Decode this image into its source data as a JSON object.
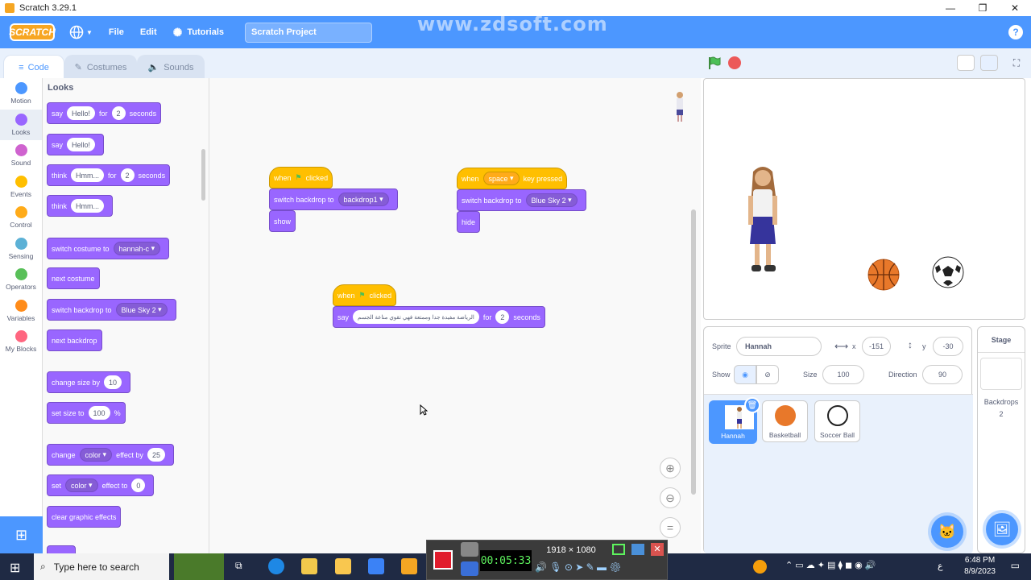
{
  "window": {
    "title": "Scratch 3.29.1",
    "min": "—",
    "max": "❐",
    "close": "✕"
  },
  "menu": {
    "logo": "SCRATCH",
    "file": "File",
    "edit": "Edit",
    "tutorials": "Tutorials",
    "project_title": "Scratch Project",
    "watermark": "www.zdsoft.com",
    "help": "?"
  },
  "tabs": {
    "code": "Code",
    "costumes": "Costumes",
    "sounds": "Sounds"
  },
  "categories": [
    {
      "label": "Motion",
      "color": "#4c97ff"
    },
    {
      "label": "Looks",
      "color": "#9966ff"
    },
    {
      "label": "Sound",
      "color": "#cf63cf"
    },
    {
      "label": "Events",
      "color": "#ffbf00"
    },
    {
      "label": "Control",
      "color": "#ffab19"
    },
    {
      "label": "Sensing",
      "color": "#5cb1d6"
    },
    {
      "label": "Operators",
      "color": "#59c059"
    },
    {
      "label": "Variables",
      "color": "#ff8c1a"
    },
    {
      "label": "My Blocks",
      "color": "#ff6680"
    }
  ],
  "palette": {
    "heading": "Looks",
    "say_for": {
      "a": "say",
      "b": "Hello!",
      "c": "for",
      "d": "2",
      "e": "seconds"
    },
    "say": {
      "a": "say",
      "b": "Hello!"
    },
    "think_for": {
      "a": "think",
      "b": "Hmm...",
      "c": "for",
      "d": "2",
      "e": "seconds"
    },
    "think": {
      "a": "think",
      "b": "Hmm..."
    },
    "switch_costume": {
      "a": "switch costume to",
      "b": "hannah-c"
    },
    "next_costume": "next costume",
    "switch_backdrop": {
      "a": "switch backdrop to",
      "b": "Blue Sky 2"
    },
    "next_backdrop": "next backdrop",
    "change_size": {
      "a": "change size by",
      "b": "10"
    },
    "set_size": {
      "a": "set size to",
      "b": "100",
      "c": "%"
    },
    "change_effect": {
      "a": "change",
      "b": "color",
      "c": "effect by",
      "d": "25"
    },
    "set_effect": {
      "a": "set",
      "b": "color",
      "c": "effect to",
      "d": "0"
    },
    "clear_effects": "clear graphic effects"
  },
  "scripts": {
    "s1": {
      "when": "when",
      "clicked": "clicked",
      "switch": "switch backdrop to",
      "backdrop": "backdrop1",
      "show": "show"
    },
    "s2": {
      "when": "when",
      "key": "space",
      "pressed": "key pressed",
      "switch": "switch backdrop to",
      "backdrop": "Blue Sky 2",
      "hide": "hide"
    },
    "s3": {
      "when": "when",
      "clicked": "clicked",
      "say": "say",
      "text": "الرياضة مفيدة جدا وممتعة فهي تقوي مناعة الجسم",
      "for": "for",
      "secs": "2",
      "seconds": "seconds"
    }
  },
  "sprite_info": {
    "sprite_label": "Sprite",
    "sprite_name": "Hannah",
    "x_label": "x",
    "x": "-151",
    "y_label": "y",
    "y": "-30",
    "show_label": "Show",
    "size_label": "Size",
    "size": "100",
    "direction_label": "Direction",
    "direction": "90"
  },
  "sprites": [
    "Hannah",
    "Basketball",
    "Soccer Ball"
  ],
  "stage_panel": {
    "title": "Stage",
    "backdrops_label": "Backdrops",
    "backdrops": "2"
  },
  "recorder": {
    "resolution": "1918 × 1080",
    "timer": "00:05:33"
  },
  "taskbar": {
    "search": "Type here to search",
    "time": "6:48 PM",
    "date": "8/9/2023",
    "lang": "ع"
  }
}
